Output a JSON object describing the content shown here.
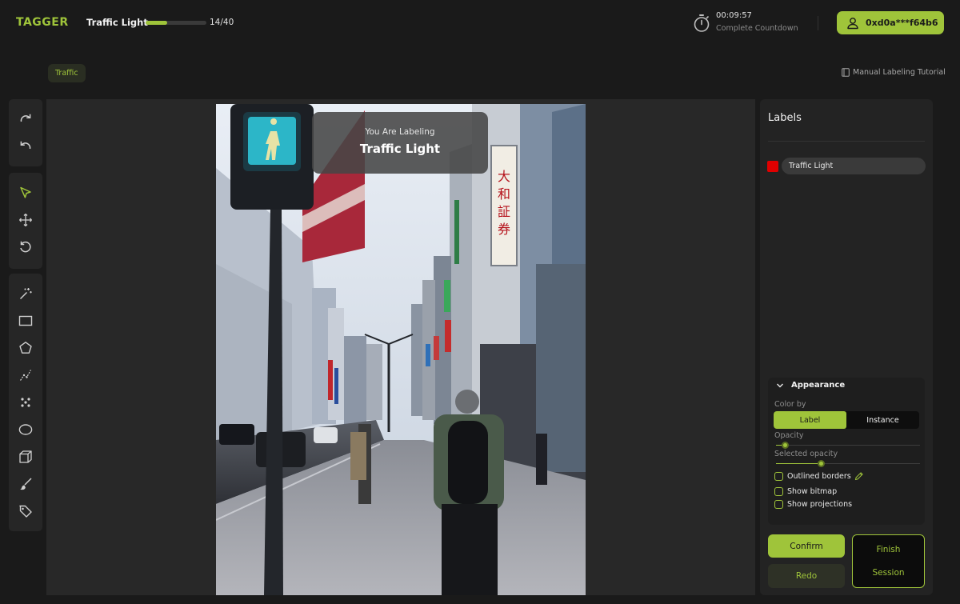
{
  "app": {
    "logo": "TAGGER"
  },
  "task": {
    "title": "Traffic Light",
    "progress_text": "14/40",
    "progress_fraction": 0.35
  },
  "timer": {
    "value": "00:09:57",
    "label": "Complete Countdown",
    "icon": "stopwatch-icon"
  },
  "wallet": {
    "address": "0xd0a***f64b6",
    "icon": "user-icon"
  },
  "category_tag": "Traffic",
  "tutorial": {
    "label": "Manual Labeling Tutorial",
    "icon": "book-icon"
  },
  "toolbar": {
    "history": [
      "redo-icon",
      "undo-icon"
    ],
    "navigation": [
      "cursor-icon",
      "move-icon",
      "reset-icon"
    ],
    "annotation": [
      "magic-wand-icon",
      "rectangle-icon",
      "polygon-icon",
      "polyline-icon",
      "points-icon",
      "ellipse-icon",
      "cuboid-icon",
      "brush-icon",
      "tag-icon"
    ]
  },
  "canvas": {
    "banner_subtitle": "You Are Labeling",
    "banner_title": "Traffic Light",
    "sign_text": [
      "大",
      "和",
      "証",
      "券"
    ]
  },
  "labels_panel": {
    "title": "Labels",
    "items": [
      {
        "name": "Traffic Light",
        "color": "#e00000"
      }
    ]
  },
  "appearance": {
    "title": "Appearance",
    "color_by_label": "Color by",
    "color_by_options": [
      "Label",
      "Instance"
    ],
    "color_by_selected": "Label",
    "opacity_label": "Opacity",
    "opacity_value": 0.05,
    "selected_opacity_label": "Selected opacity",
    "selected_opacity_value": 0.3,
    "checkboxes": [
      {
        "label": "Outlined borders",
        "checked": false
      },
      {
        "label": "Show bitmap",
        "checked": false
      },
      {
        "label": "Show projections",
        "checked": false
      }
    ]
  },
  "actions": {
    "confirm": "Confirm",
    "redo": "Redo",
    "finish_line1": "Finish",
    "finish_line2": "Session"
  },
  "colors": {
    "accent": "#9fc43a",
    "background": "#1a1a1a",
    "panel": "#232323",
    "label_red": "#e00000"
  }
}
